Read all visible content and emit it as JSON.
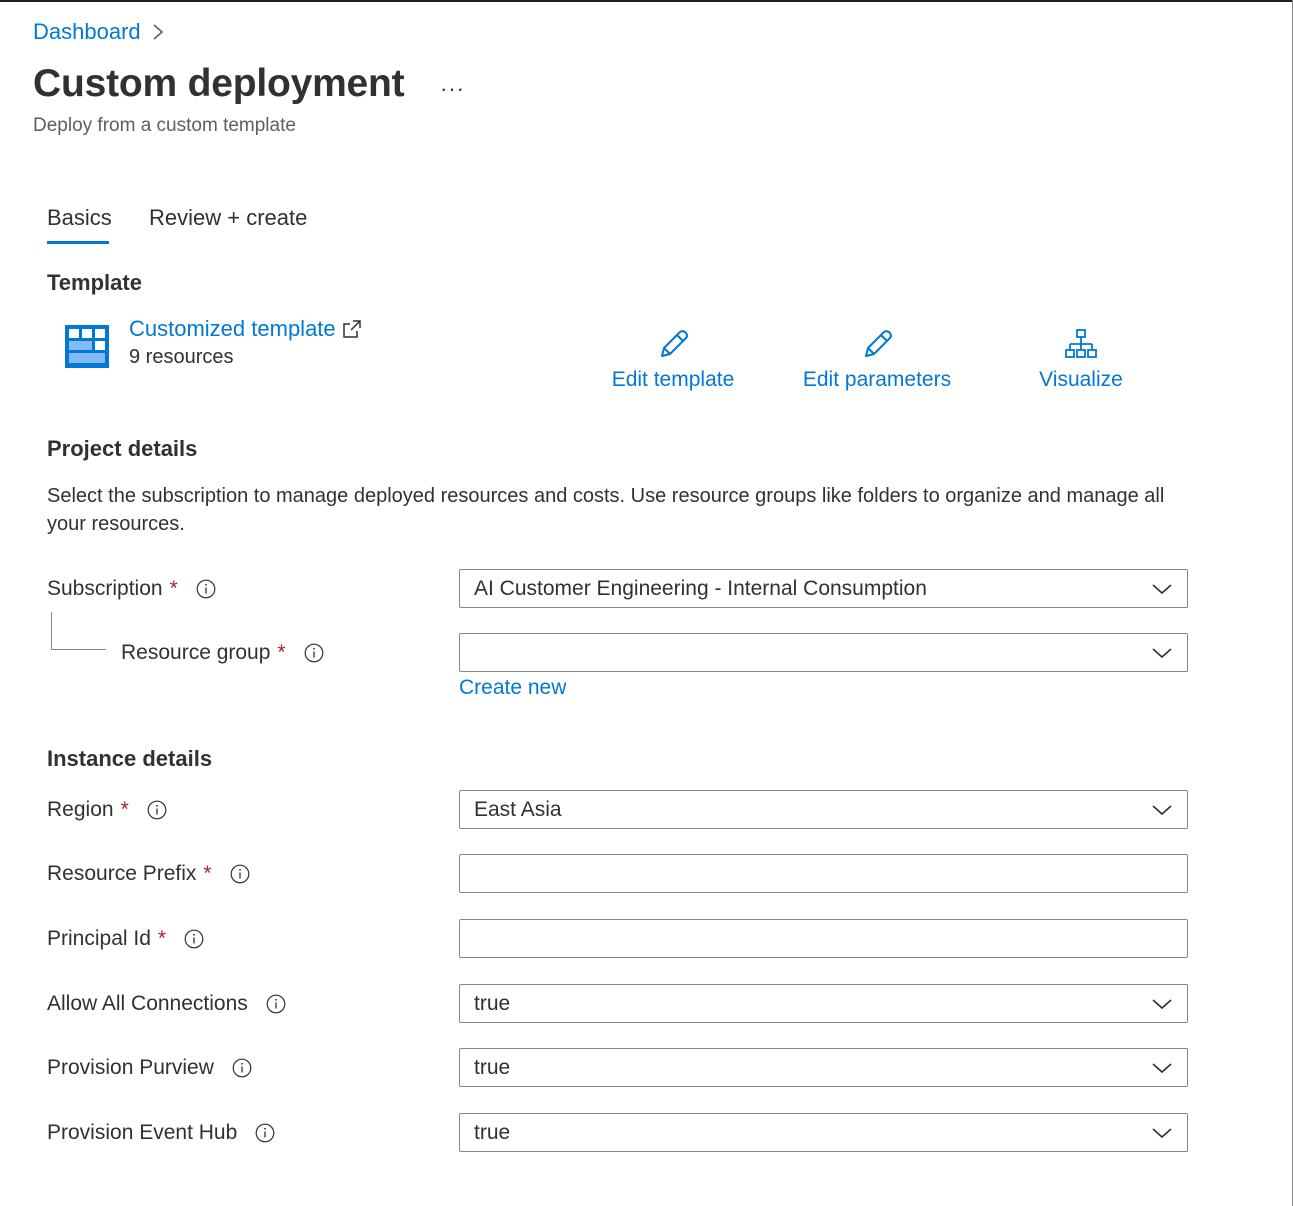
{
  "breadcrumb": {
    "item": "Dashboard"
  },
  "header": {
    "title": "Custom deployment",
    "more": "···",
    "subtitle": "Deploy from a custom template"
  },
  "tabs": [
    {
      "label": "Basics",
      "active": true
    },
    {
      "label": "Review + create",
      "active": false
    }
  ],
  "template": {
    "heading": "Template",
    "link_label": "Customized template",
    "resource_count": "9 resources",
    "actions": [
      {
        "label": "Edit template",
        "icon": "pencil-icon"
      },
      {
        "label": "Edit parameters",
        "icon": "pencil-icon"
      },
      {
        "label": "Visualize",
        "icon": "hierarchy-icon"
      }
    ]
  },
  "project": {
    "heading": "Project details",
    "description": "Select the subscription to manage deployed resources and costs. Use resource groups like folders to organize and manage all your resources.",
    "subscription": {
      "label": "Subscription",
      "required": "*",
      "value": "AI Customer Engineering - Internal Consumption"
    },
    "resource_group": {
      "label": "Resource group",
      "required": "*",
      "value": ""
    },
    "create_new": "Create new"
  },
  "instance": {
    "heading": "Instance details",
    "region": {
      "label": "Region",
      "required": "*",
      "value": "East Asia"
    },
    "resource_prefix": {
      "label": "Resource Prefix",
      "required": "*",
      "value": ""
    },
    "principal_id": {
      "label": "Principal Id",
      "required": "*",
      "value": ""
    },
    "allow_all_connections": {
      "label": "Allow All Connections",
      "value": "true"
    },
    "provision_purview": {
      "label": "Provision Purview",
      "value": "true"
    },
    "provision_event_hub": {
      "label": "Provision Event Hub",
      "value": "true"
    }
  },
  "colors": {
    "link": "#0078d4",
    "required": "#a4262c",
    "border": "#8a8886",
    "text": "#323130"
  }
}
